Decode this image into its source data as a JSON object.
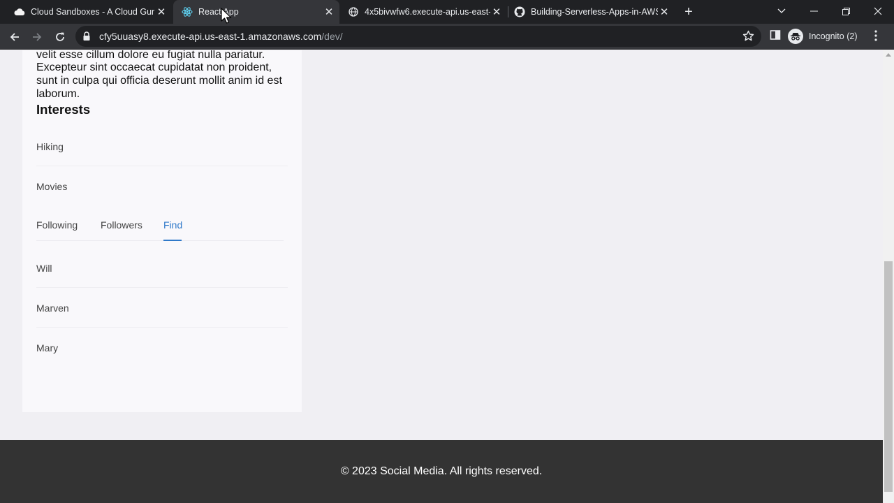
{
  "browser": {
    "tabs": [
      {
        "title": "Cloud Sandboxes - A Cloud Guru",
        "icon": "cloud-icon",
        "active": false
      },
      {
        "title": "React App",
        "icon": "react-icon",
        "active": true
      },
      {
        "title": "4x5bivwfw6.execute-api.us-east-",
        "icon": "globe-icon",
        "active": false
      },
      {
        "title": "Building-Serverless-Apps-in-AWS",
        "icon": "github-icon",
        "active": false
      }
    ],
    "new_tab_label": "+",
    "url_host": "cfy5uuasy8.execute-api.us-east-1.amazonaws.com",
    "url_path": "/dev/",
    "profile_label": "Incognito (2)"
  },
  "profile": {
    "bio_text": "laboris nisi ut aliquip ex ea commodo consequat. Duis aute irure dolor in reprehenderit in voluptate velit esse cillum dolore eu fugiat nulla pariatur. Excepteur sint occaecat cupidatat non proident, sunt in culpa qui officia deserunt mollit anim id est laborum.",
    "interests_title": "Interests",
    "interests": [
      "Hiking",
      "Movies"
    ],
    "tabs": [
      {
        "label": "Following",
        "active": false
      },
      {
        "label": "Followers",
        "active": false
      },
      {
        "label": "Find",
        "active": true
      }
    ],
    "people": [
      "Will",
      "Marven",
      "Mary"
    ]
  },
  "footer": {
    "text": "© 2023 Social Media. All rights reserved."
  },
  "colors": {
    "accent": "#2f79c9",
    "footer_bg": "#333333",
    "page_bg": "#f0eff3",
    "card_bg": "#f9f8fb"
  }
}
